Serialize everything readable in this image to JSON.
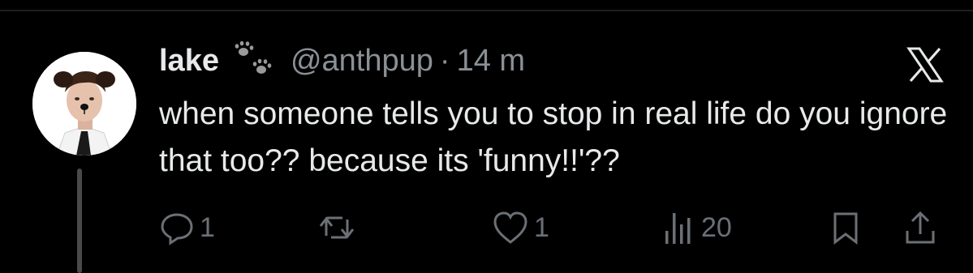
{
  "tweet": {
    "display_name": "lake",
    "name_icon": "paw-prints-icon",
    "handle": "@anthpup",
    "separator": "·",
    "time": "14 m",
    "text": "when someone tells you to stop in real life do you ignore that too?? because its 'funny!!'??"
  },
  "platform_logo": "x-logo",
  "actions": {
    "reply": {
      "icon": "reply-icon",
      "count": "1"
    },
    "repost": {
      "icon": "repost-icon",
      "count": ""
    },
    "like": {
      "icon": "heart-icon",
      "count": "1"
    },
    "views": {
      "icon": "views-icon",
      "count": "20"
    },
    "bookmark": {
      "icon": "bookmark-icon"
    },
    "share": {
      "icon": "share-icon"
    }
  },
  "colors": {
    "background": "#000000",
    "text": "#e7e9ea",
    "secondary_text": "#8b9096",
    "action_icons": "#6b7076"
  }
}
